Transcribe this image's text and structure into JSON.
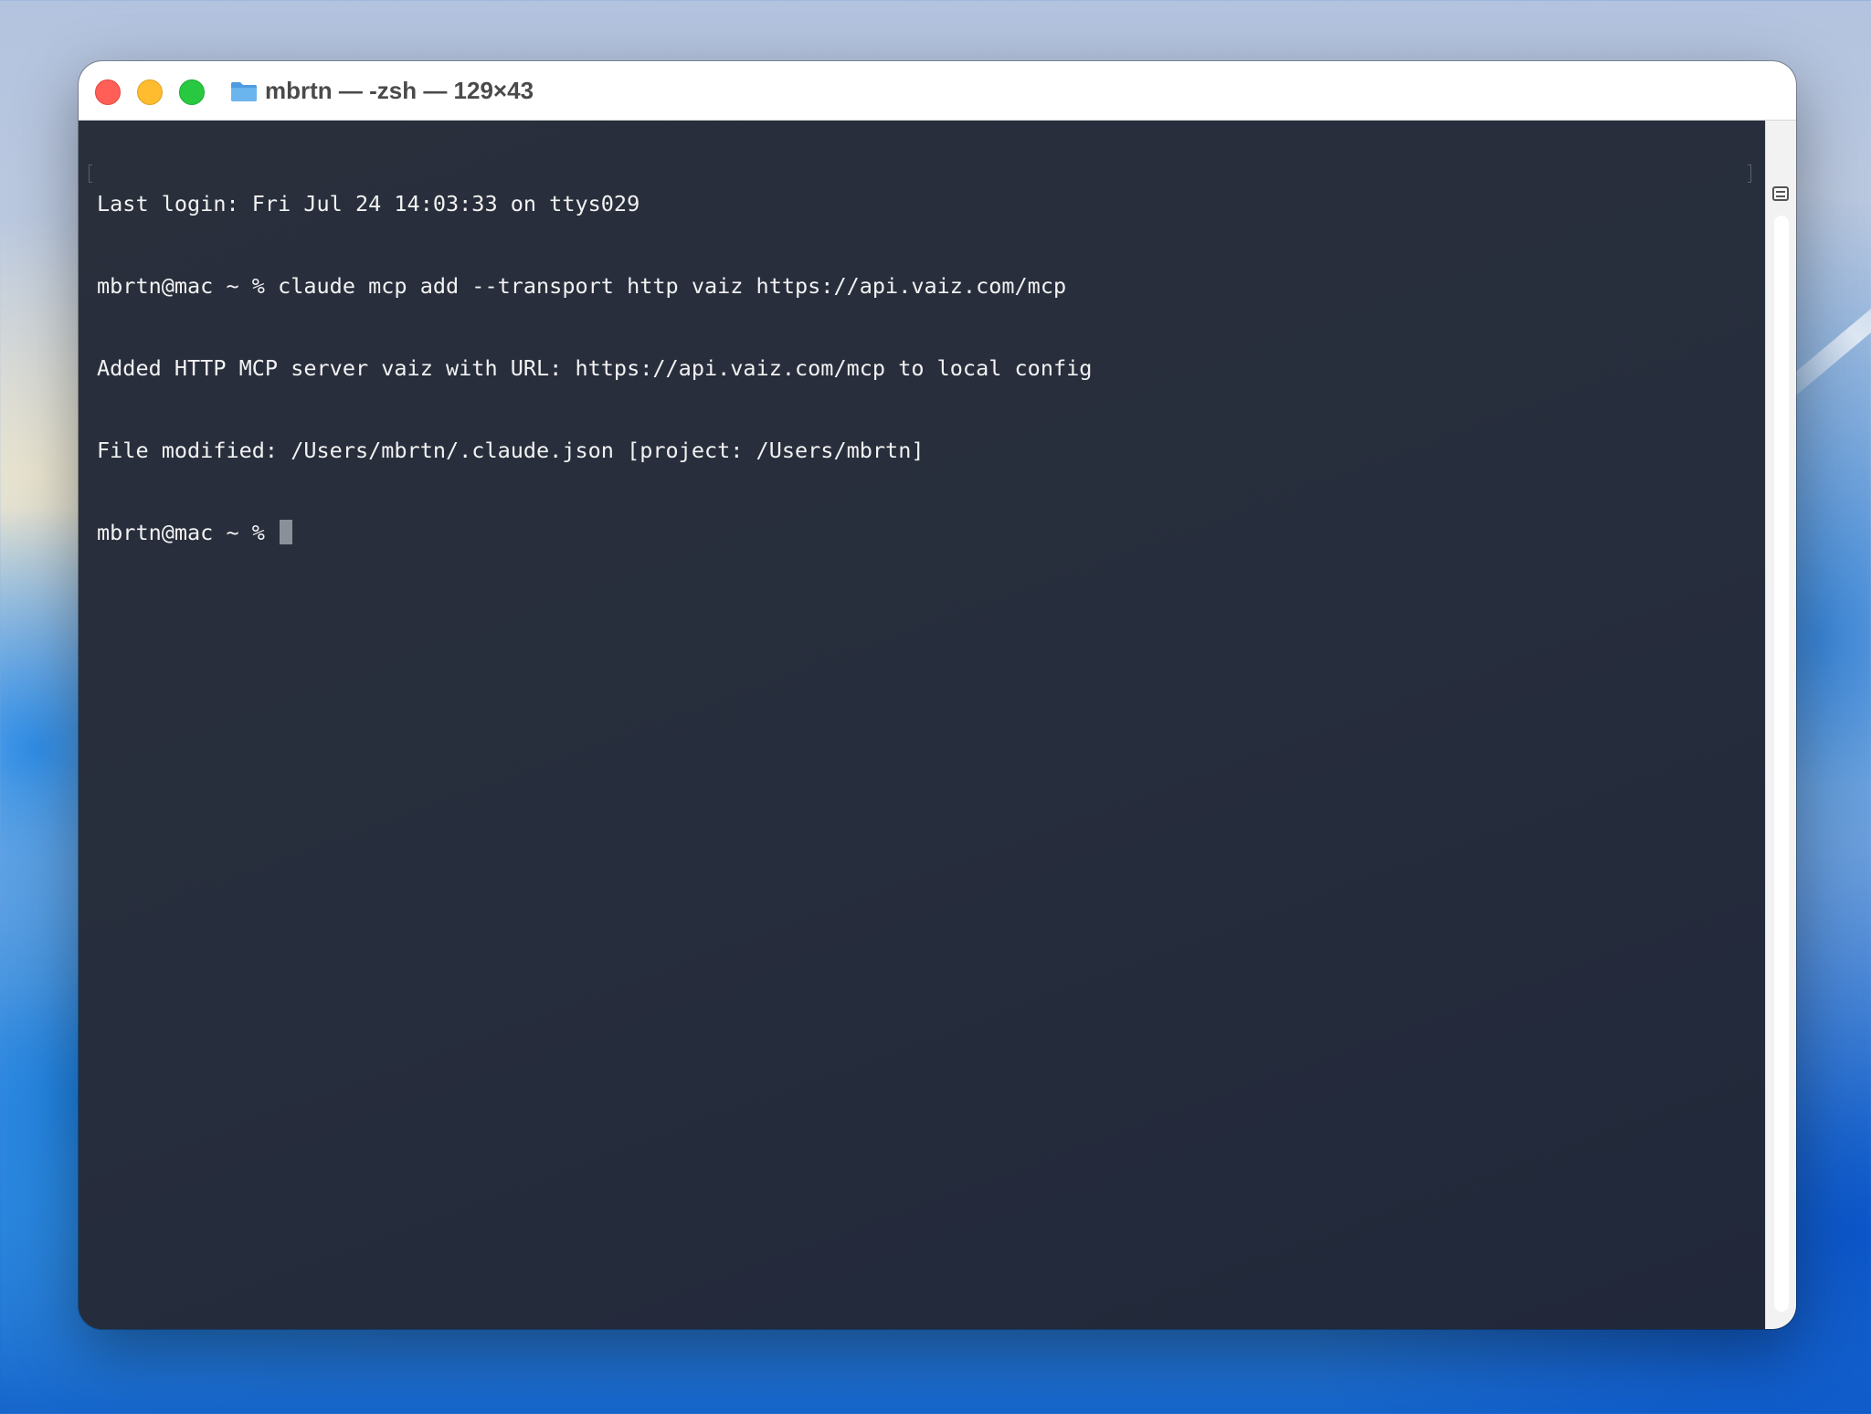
{
  "window": {
    "title": "mbrtn — -zsh — 129×43",
    "controls": {
      "close": "close",
      "minimize": "minimize",
      "maximize": "zoom"
    }
  },
  "terminal": {
    "lines": [
      "Last login: Fri Jul 24 14:03:33 on ttys029",
      "mbrtn@mac ~ % claude mcp add --transport http vaiz https://api.vaiz.com/mcp",
      "Added HTTP MCP server vaiz with URL: https://api.vaiz.com/mcp to local config",
      "File modified: /Users/mbrtn/.claude.json [project: /Users/mbrtn]"
    ],
    "prompt": "mbrtn@mac ~ % "
  },
  "colors": {
    "terminal_bg": "#272d3b",
    "terminal_fg": "#f2f2f2",
    "close": "#ff5f57",
    "minimize": "#febc2e",
    "maximize": "#28c840",
    "folder": "#5aa8e6"
  },
  "icons": {
    "title_icon": "folder-icon",
    "scroll_toggle": "list-icon"
  }
}
